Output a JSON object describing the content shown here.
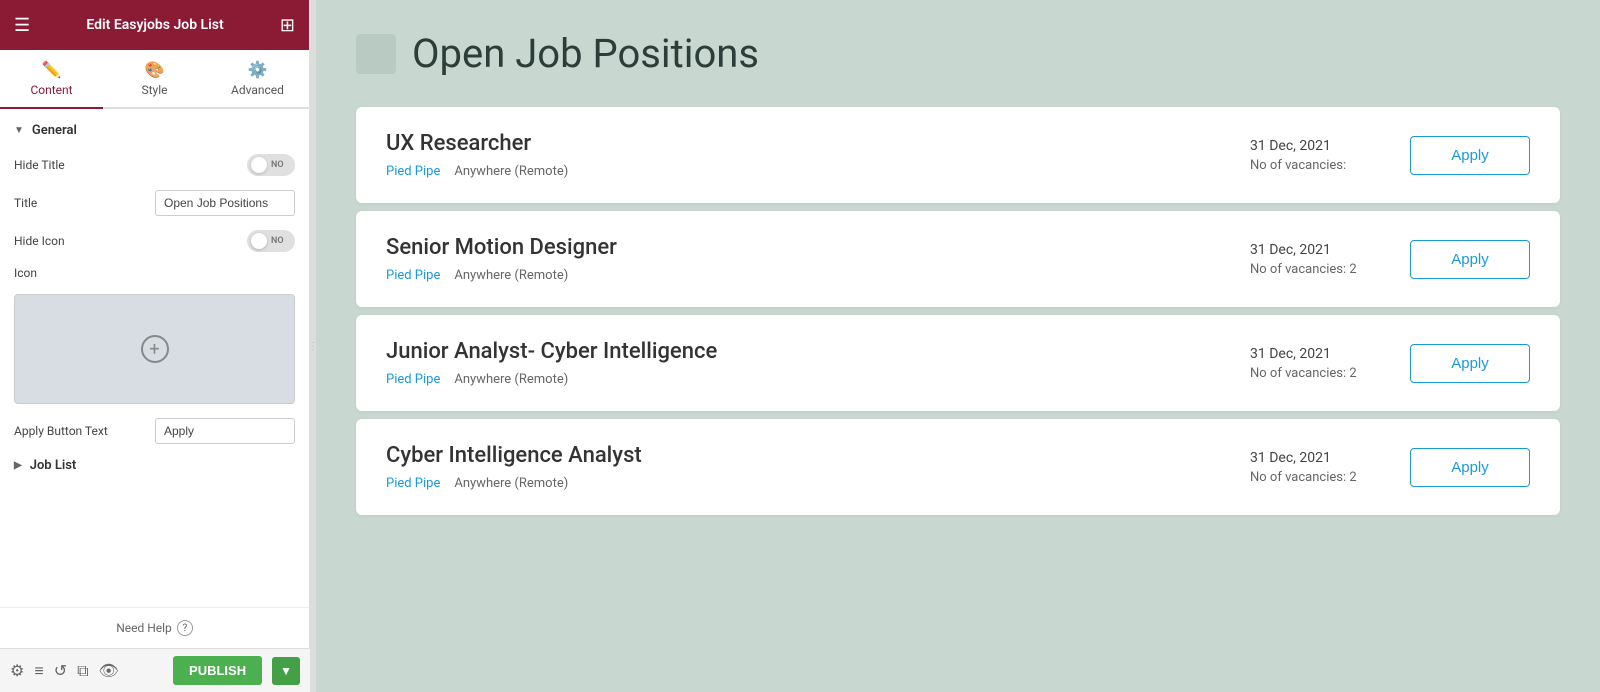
{
  "header": {
    "title": "Edit Easyjobs Job List",
    "menu_icon": "☰",
    "grid_icon": "⊞"
  },
  "tabs": [
    {
      "id": "content",
      "label": "Content",
      "icon": "✏️",
      "active": true
    },
    {
      "id": "style",
      "label": "Style",
      "icon": "🎨",
      "active": false
    },
    {
      "id": "advanced",
      "label": "Advanced",
      "icon": "⚙️",
      "active": false
    }
  ],
  "general_section": {
    "label": "General",
    "hide_title": {
      "label": "Hide Title",
      "toggle_text": "NO"
    },
    "title": {
      "label": "Title",
      "value": "Open Job Positions"
    },
    "hide_icon": {
      "label": "Hide Icon",
      "toggle_text": "NO"
    },
    "icon": {
      "label": "Icon"
    },
    "apply_button_text": {
      "label": "Apply Button Text",
      "value": "Apply"
    }
  },
  "job_list_section": {
    "label": "Job List"
  },
  "footer": {
    "need_help": "Need Help"
  },
  "bottom_bar": {
    "publish_label": "PUBLISH"
  },
  "main": {
    "page_title": "Open Job Positions",
    "jobs": [
      {
        "id": 1,
        "title": "UX Researcher",
        "company": "Pied Pipe",
        "location": "Anywhere (Remote)",
        "date": "31 Dec, 2021",
        "vacancies": "No of vacancies:",
        "apply_label": "Apply"
      },
      {
        "id": 2,
        "title": "Senior Motion Designer",
        "company": "Pied Pipe",
        "location": "Anywhere (Remote)",
        "date": "31 Dec, 2021",
        "vacancies": "No of vacancies: 2",
        "apply_label": "Apply"
      },
      {
        "id": 3,
        "title": "Junior Analyst- Cyber Intelligence",
        "company": "Pied Pipe",
        "location": "Anywhere (Remote)",
        "date": "31 Dec, 2021",
        "vacancies": "No of vacancies: 2",
        "apply_label": "Apply"
      },
      {
        "id": 4,
        "title": "Cyber Intelligence Analyst",
        "company": "Pied Pipe",
        "location": "Anywhere (Remote)",
        "date": "31 Dec, 2021",
        "vacancies": "No of vacancies: 2",
        "apply_label": "Apply"
      }
    ]
  }
}
